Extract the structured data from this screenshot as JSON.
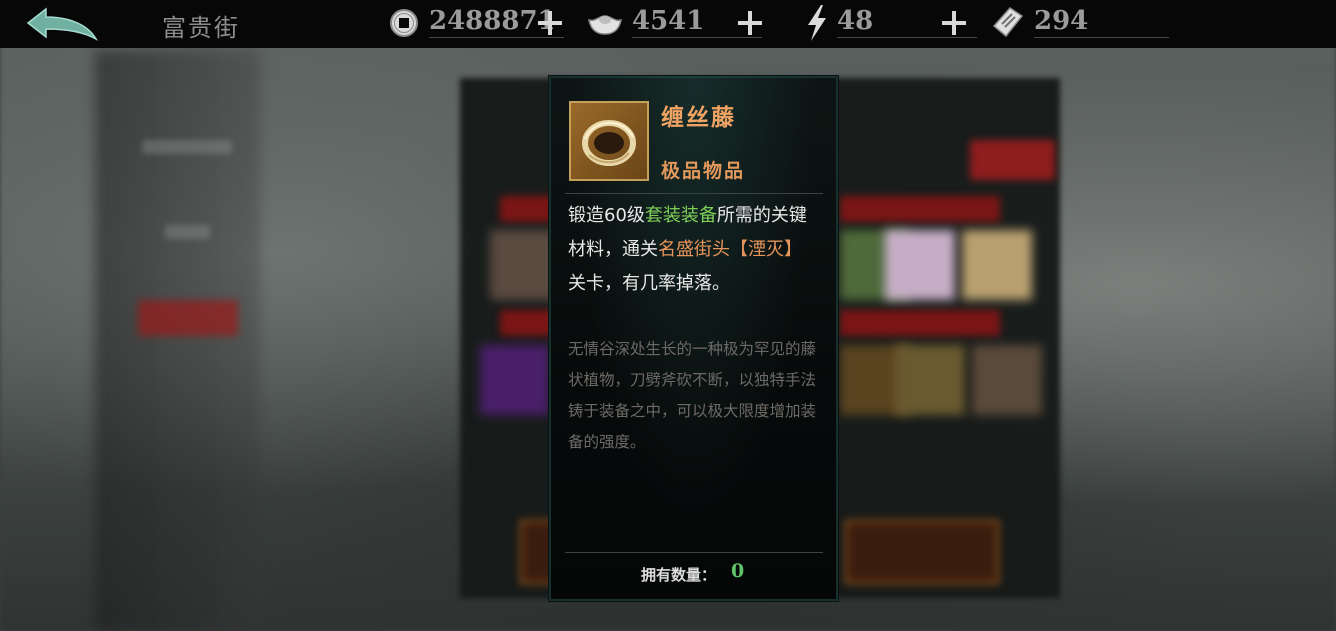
{
  "topbar": {
    "location": "富贵街",
    "back_icon": "back-arrow-icon",
    "resources": [
      {
        "name": "coins",
        "icon": "copper-coin-icon",
        "value": "2488871"
      },
      {
        "name": "silver",
        "icon": "silver-ingot-icon",
        "value": "4541"
      },
      {
        "name": "stamina",
        "icon": "lightning-icon",
        "value": "48"
      },
      {
        "name": "tickets",
        "icon": "ticket-icon",
        "value": "294"
      }
    ]
  },
  "tooltip": {
    "item_name": "缠丝藤",
    "item_grade": "极品物品",
    "item_icon": "vine-ring-icon",
    "desc_1": "锻造60级",
    "desc_2": "套装装备",
    "desc_3": "所需的关键材料，通关",
    "desc_4": "名盛街头【湮灭】",
    "desc_5": "关卡，有几率掉落。",
    "lore": "无情谷深处生长的一种极为罕见的藤状植物，刀劈斧砍不断，以独特手法铸于装备之中，可以极大限度增加装备的强度。",
    "owned_label": "拥有数量：",
    "owned_value": "0"
  },
  "colors": {
    "name": "#f0a463",
    "highlight_green": "#7ecf5a",
    "highlight_orange": "#e6955a",
    "lore": "#6d6a66",
    "owned": "#62c46a"
  }
}
